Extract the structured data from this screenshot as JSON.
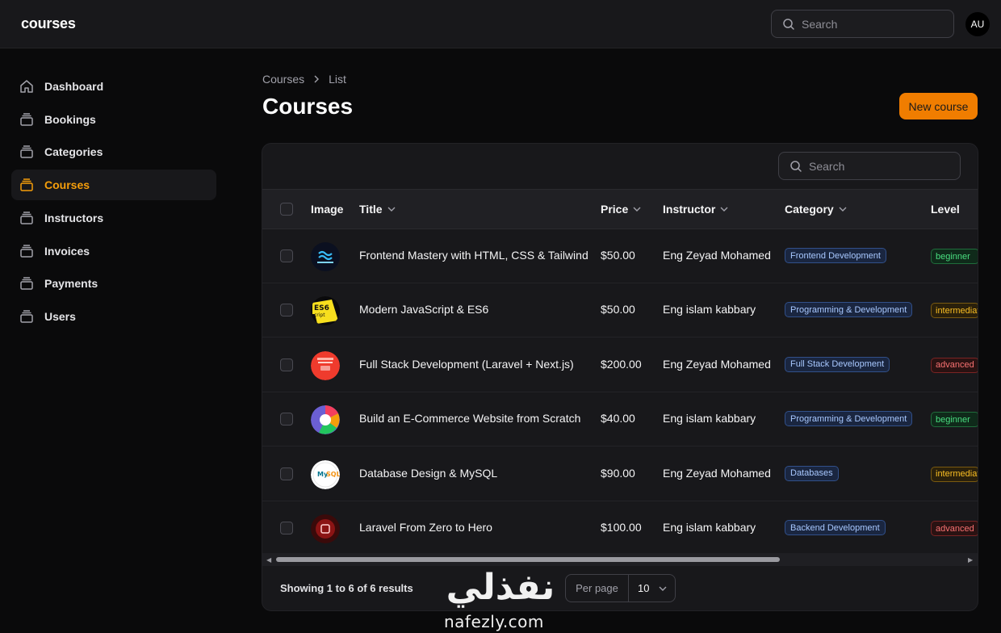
{
  "app": {
    "brand": "courses",
    "user_initials": "AU"
  },
  "topbar": {
    "search_placeholder": "Search"
  },
  "sidebar": {
    "items": [
      {
        "label": "Dashboard",
        "icon": "home-icon",
        "active": false
      },
      {
        "label": "Bookings",
        "icon": "stack-icon",
        "active": false
      },
      {
        "label": "Categories",
        "icon": "stack-icon",
        "active": false
      },
      {
        "label": "Courses",
        "icon": "stack-icon",
        "active": true
      },
      {
        "label": "Instructors",
        "icon": "stack-icon",
        "active": false
      },
      {
        "label": "Invoices",
        "icon": "stack-icon",
        "active": false
      },
      {
        "label": "Payments",
        "icon": "stack-icon",
        "active": false
      },
      {
        "label": "Users",
        "icon": "stack-icon",
        "active": false
      }
    ]
  },
  "breadcrumb": {
    "parent": "Courses",
    "current": "List"
  },
  "page": {
    "title": "Courses",
    "new_button": "New course"
  },
  "table": {
    "search_placeholder": "Search",
    "columns": {
      "image": "Image",
      "title": "Title",
      "price": "Price",
      "instructor": "Instructor",
      "category": "Category",
      "level": "Level"
    },
    "rows": [
      {
        "thumb": "tailwind",
        "thumb_text": "Tailwind CSS",
        "title": "Frontend Mastery with HTML, CSS & Tailwind",
        "price": "$50.00",
        "instructor": "Eng Zeyad Mohamed",
        "category": "Frontend Development",
        "level": "beginner"
      },
      {
        "thumb": "es6",
        "thumb_text": "ES6 script",
        "title": "Modern JavaScript & ES6",
        "price": "$50.00",
        "instructor": "Eng islam kabbary",
        "category": "Programming & Development",
        "level": "intermediate"
      },
      {
        "thumb": "laravel-next",
        "thumb_text": "",
        "title": "Full Stack Development (Laravel + Next.js)",
        "price": "$200.00",
        "instructor": "Eng Zeyad Mohamed",
        "category": "Full Stack Development",
        "level": "advanced"
      },
      {
        "thumb": "ecommerce",
        "thumb_text": "",
        "title": "Build an E-Commerce Website from Scratch",
        "price": "$40.00",
        "instructor": "Eng islam kabbary",
        "category": "Programming & Development",
        "level": "beginner"
      },
      {
        "thumb": "mysql",
        "thumb_text": "MySQL",
        "title": "Database Design & MySQL",
        "price": "$90.00",
        "instructor": "Eng Zeyad Mohamed",
        "category": "Databases",
        "level": "intermediate"
      },
      {
        "thumb": "laravel",
        "thumb_text": "",
        "title": "Laravel From Zero to Hero",
        "price": "$100.00",
        "instructor": "Eng islam kabbary",
        "category": "Backend Development",
        "level": "advanced"
      }
    ]
  },
  "pagination": {
    "summary": "Showing 1 to 6 of 6 results",
    "per_page_label": "Per page",
    "per_page_value": "10"
  },
  "watermark": {
    "arabic": "نفذلي",
    "latin": "nafezly.com"
  },
  "colors": {
    "accent": "#f07d00",
    "active_nav": "#f59e0b"
  }
}
